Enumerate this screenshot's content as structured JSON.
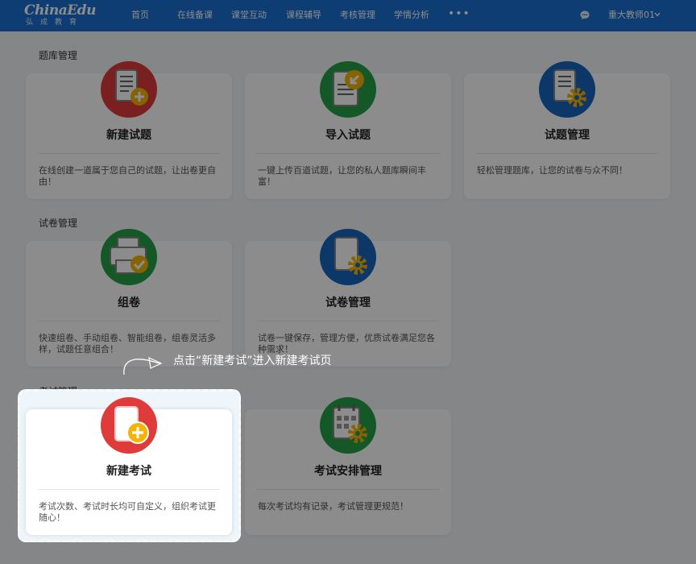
{
  "header": {
    "logo_main": "ChinaEdu",
    "logo_sub": "弘成教育",
    "nav": [
      "首页",
      "在线备课",
      "课堂互动",
      "课程辅导",
      "考核管理",
      "学情分析"
    ],
    "more": "•••",
    "user": "重大教师01"
  },
  "sections": [
    {
      "title": "题库管理",
      "cards": [
        {
          "title": "新建试题",
          "desc": "在线创建一道属于您自己的试题，让出卷更自由！",
          "icon": "doc-plus-icon",
          "color": "#e03b3b"
        },
        {
          "title": "导入试题",
          "desc": "一键上传百道试题，让您的私人题库瞬间丰富！",
          "icon": "doc-import-icon",
          "color": "#27a04a"
        },
        {
          "title": "试题管理",
          "desc": "轻松管理题库，让您的试卷与众不同！",
          "icon": "doc-gear-icon",
          "color": "#1565c0"
        }
      ]
    },
    {
      "title": "试卷管理",
      "cards": [
        {
          "title": "组卷",
          "desc": "快速组卷、手动组卷、智能组卷，组卷灵活多样，试题任意组合！",
          "icon": "printer-check-icon",
          "color": "#27a04a"
        },
        {
          "title": "试卷管理",
          "desc": "试卷一键保存，管理方便，优质试卷满足您各种需求！",
          "icon": "paper-gear-icon",
          "color": "#1565c0"
        }
      ]
    },
    {
      "title": "考试管理",
      "cards": [
        {
          "title": "新建考试",
          "desc": "考试次数、考试时长均可自定义，组织考试更随心！",
          "icon": "exam-plus-icon",
          "color": "#e03b3b"
        },
        {
          "title": "考试安排管理",
          "desc": "每次考试均有记录，考试管理更规范！",
          "icon": "calendar-gear-icon",
          "color": "#27a04a"
        }
      ]
    }
  ],
  "hint": {
    "text": "点击“新建考试”进入新建考试页"
  },
  "colors": {
    "header": "#1b6fd1",
    "accent_yellow": "#f4b400"
  }
}
